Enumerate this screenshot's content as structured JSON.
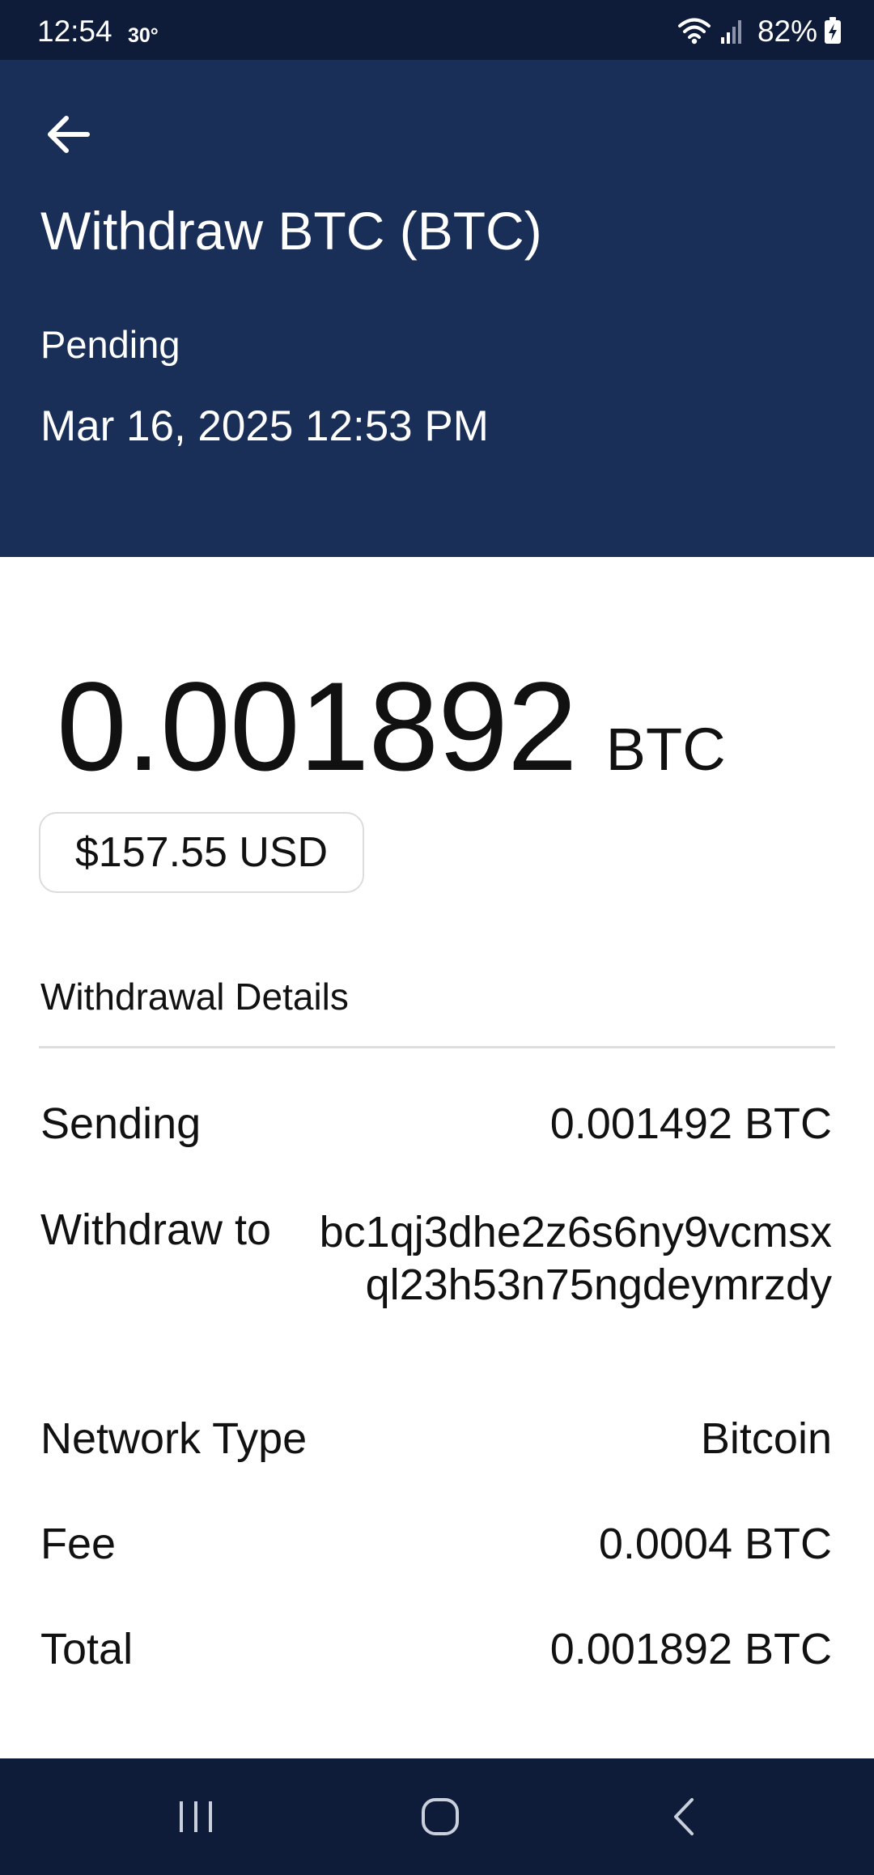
{
  "status_bar": {
    "time": "12:54",
    "temperature": "30°",
    "battery": "82%",
    "icons": [
      "wifi-icon",
      "signal-icon",
      "battery-charging-icon"
    ]
  },
  "header": {
    "back_icon": "arrow-left-icon",
    "title": "Withdraw BTC (BTC)",
    "status": "Pending",
    "date": "Mar 16, 2025 12:53 PM",
    "background_color": "#1a2f58"
  },
  "amount": {
    "value": "0.001892",
    "unit": "BTC",
    "usd": "$157.55 USD"
  },
  "details": {
    "heading": "Withdrawal Details",
    "rows": [
      {
        "label": "Sending",
        "value": "0.001492 BTC"
      },
      {
        "label": "Withdraw to",
        "value": "bc1qj3dhe2z6s6ny9vcmsxql23h53n75ngdeymrzdy"
      },
      {
        "label": "Network Type",
        "value": "Bitcoin"
      },
      {
        "label": "Fee",
        "value": "0.0004 BTC"
      },
      {
        "label": "Total",
        "value": "0.001892 BTC"
      }
    ]
  },
  "nav_bar": {
    "buttons": [
      "recent-apps-icon",
      "home-icon",
      "back-icon"
    ],
    "background_color": "#0e1c3a"
  }
}
